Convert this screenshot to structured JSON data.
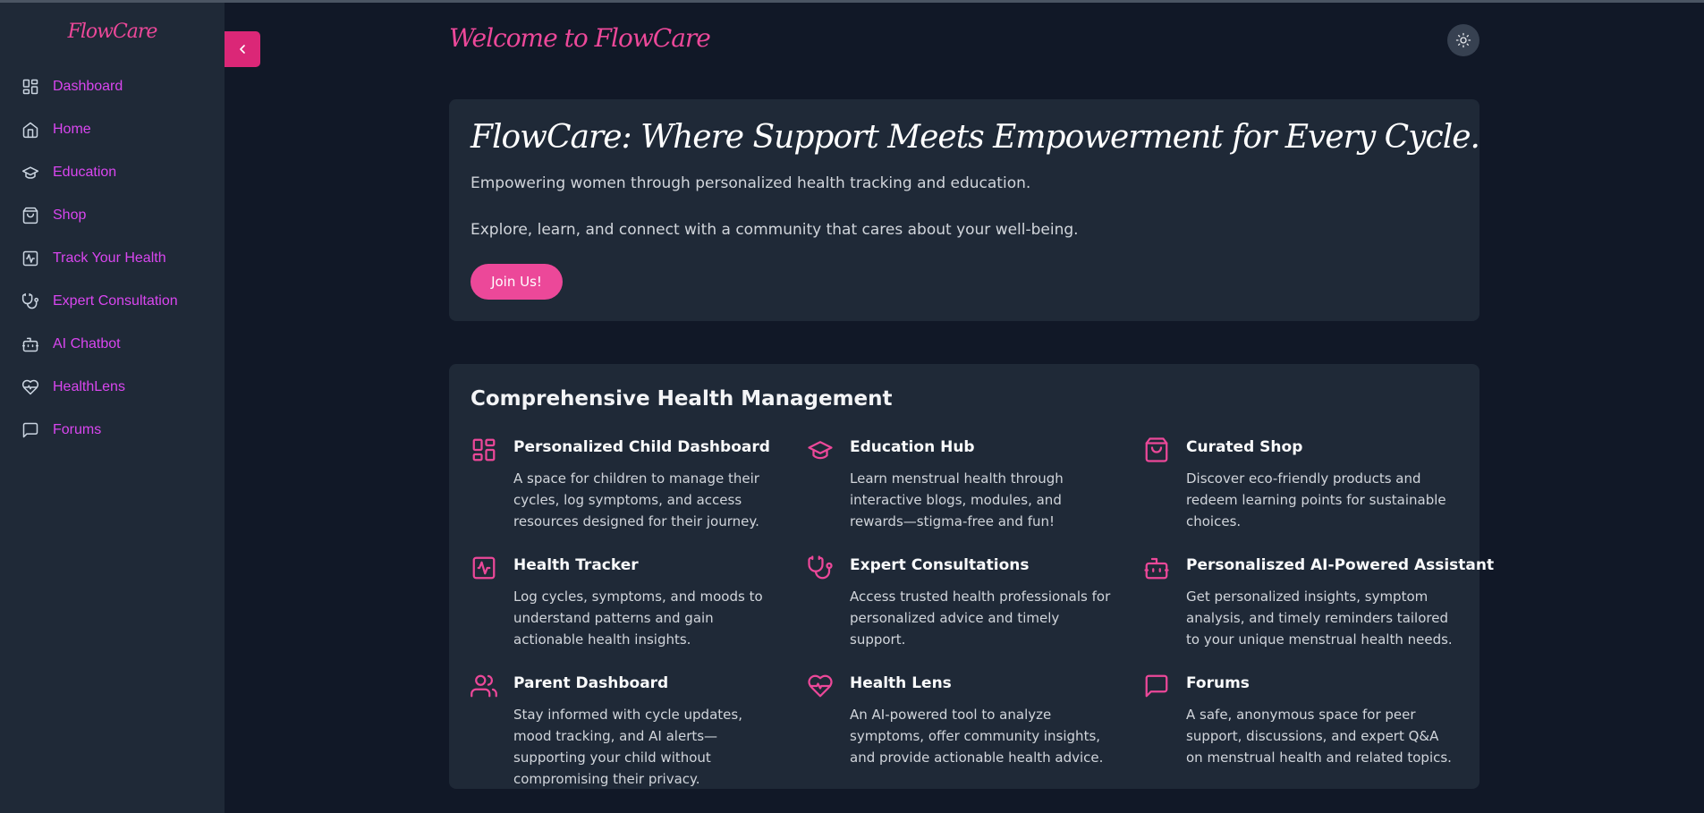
{
  "app": {
    "logo": "FlowCare"
  },
  "sidebar": {
    "items": [
      {
        "label": "Dashboard",
        "icon": "dashboard-icon"
      },
      {
        "label": "Home",
        "icon": "home-icon"
      },
      {
        "label": "Education",
        "icon": "graduation-cap-icon"
      },
      {
        "label": "Shop",
        "icon": "shopping-bag-icon"
      },
      {
        "label": "Track Your Health",
        "icon": "activity-square-icon"
      },
      {
        "label": "Expert Consultation",
        "icon": "stethoscope-icon"
      },
      {
        "label": "AI Chatbot",
        "icon": "bot-icon"
      },
      {
        "label": "HealthLens",
        "icon": "heart-pulse-icon"
      },
      {
        "label": "Forums",
        "icon": "message-square-icon"
      }
    ]
  },
  "header": {
    "welcome": "Welcome to FlowCare"
  },
  "hero": {
    "title": "FlowCare: Where Support Meets Empowerment for Every Cycle.",
    "line1": "Empowering women through personalized health tracking and education.",
    "line2": "Explore, learn, and connect with a community that cares about your well-being.",
    "cta": "Join Us!"
  },
  "features": {
    "title": "Comprehensive Health Management",
    "items": [
      {
        "title": "Personalized Child Dashboard",
        "desc": "A space for children to manage their cycles, log symptoms, and access resources designed for their journey.",
        "icon": "dashboard-icon"
      },
      {
        "title": "Education Hub",
        "desc": "Learn menstrual health through interactive blogs, modules, and rewards—stigma-free and fun!",
        "icon": "graduation-cap-icon"
      },
      {
        "title": "Curated Shop",
        "desc": "Discover eco-friendly products and redeem learning points for sustainable choices.",
        "icon": "shopping-bag-icon"
      },
      {
        "title": "Health Tracker",
        "desc": "Log cycles, symptoms, and moods to understand patterns and gain actionable health insights.",
        "icon": "activity-square-icon"
      },
      {
        "title": "Expert Consultations",
        "desc": "Access trusted health professionals for personalized advice and timely support.",
        "icon": "stethoscope-icon"
      },
      {
        "title": "Personaliszed AI-Powered Assistant",
        "desc": "Get personalized insights, symptom analysis, and timely reminders tailored to your unique menstrual health needs.",
        "icon": "bot-icon"
      },
      {
        "title": "Parent Dashboard",
        "desc": "Stay informed with cycle updates, mood tracking, and AI alerts—supporting your child without compromising their privacy.",
        "icon": "users-icon"
      },
      {
        "title": "Health Lens",
        "desc": "An AI-powered tool to analyze symptoms, offer community insights, and provide actionable health advice.",
        "icon": "heart-pulse-icon"
      },
      {
        "title": "Forums",
        "desc": "A safe, anonymous space for peer support, discussions, and expert Q&A on menstrual health and related topics.",
        "icon": "message-square-icon"
      }
    ]
  },
  "colors": {
    "accent": "#ec4899",
    "nav_text": "#d946ef",
    "background": "#111827",
    "panel": "#1f2937"
  }
}
